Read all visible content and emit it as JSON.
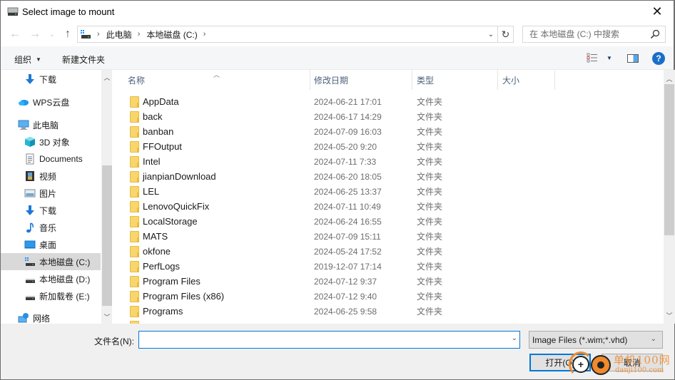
{
  "window": {
    "title": "Select image to mount",
    "close_label": "✕"
  },
  "nav": {
    "back_icon": "←",
    "forward_icon": "→",
    "recent_icon": "⌄",
    "up_icon": "↑",
    "breadcrumbs": [
      "此电脑",
      "本地磁盘 (C:)"
    ],
    "refresh_icon": "↻",
    "search_placeholder": "在 本地磁盘 (C:) 中搜索"
  },
  "toolbar": {
    "organize_label": "组织",
    "new_folder_label": "新建文件夹",
    "help_label": "?"
  },
  "sidebar": {
    "items": [
      {
        "label": "下载",
        "icon": "download-icon",
        "indent": 2
      },
      {
        "label": "WPS云盘",
        "icon": "cloud-icon",
        "indent": 1
      },
      {
        "label": "此电脑",
        "icon": "computer-icon",
        "indent": 1
      },
      {
        "label": "3D 对象",
        "icon": "3d-objects-icon",
        "indent": 2
      },
      {
        "label": "Documents",
        "icon": "documents-icon",
        "indent": 2
      },
      {
        "label": "视频",
        "icon": "video-icon",
        "indent": 2
      },
      {
        "label": "图片",
        "icon": "pictures-icon",
        "indent": 2
      },
      {
        "label": "下载",
        "icon": "download-icon",
        "indent": 2
      },
      {
        "label": "音乐",
        "icon": "music-icon",
        "indent": 2
      },
      {
        "label": "桌面",
        "icon": "desktop-icon",
        "indent": 2
      },
      {
        "label": "本地磁盘 (C:)",
        "icon": "system-drive-icon",
        "indent": 2,
        "selected": true
      },
      {
        "label": "本地磁盘 (D:)",
        "icon": "drive-icon",
        "indent": 2
      },
      {
        "label": "新加载卷 (E:)",
        "icon": "drive-icon",
        "indent": 2
      },
      {
        "label": "网络",
        "icon": "network-icon",
        "indent": 1
      }
    ]
  },
  "filelist": {
    "columns": [
      "名称",
      "修改日期",
      "类型",
      "大小"
    ],
    "rows": [
      {
        "name": "AppData",
        "date": "2024-06-21 17:01",
        "type": "文件夹"
      },
      {
        "name": "back",
        "date": "2024-06-17 14:29",
        "type": "文件夹"
      },
      {
        "name": "banban",
        "date": "2024-07-09 16:03",
        "type": "文件夹"
      },
      {
        "name": "FFOutput",
        "date": "2024-05-20 9:20",
        "type": "文件夹"
      },
      {
        "name": "Intel",
        "date": "2024-07-11 7:33",
        "type": "文件夹"
      },
      {
        "name": "jianpianDownload",
        "date": "2024-06-20 18:05",
        "type": "文件夹"
      },
      {
        "name": "LEL",
        "date": "2024-06-25 13:37",
        "type": "文件夹"
      },
      {
        "name": "LenovoQuickFix",
        "date": "2024-07-11 10:49",
        "type": "文件夹"
      },
      {
        "name": "LocalStorage",
        "date": "2024-06-24 16:55",
        "type": "文件夹"
      },
      {
        "name": "MATS",
        "date": "2024-07-09 15:11",
        "type": "文件夹"
      },
      {
        "name": "okfone",
        "date": "2024-05-24 17:52",
        "type": "文件夹"
      },
      {
        "name": "PerfLogs",
        "date": "2019-12-07 17:14",
        "type": "文件夹"
      },
      {
        "name": "Program Files",
        "date": "2024-07-12 9:37",
        "type": "文件夹"
      },
      {
        "name": "Program Files (x86)",
        "date": "2024-07-12 9:40",
        "type": "文件夹"
      },
      {
        "name": "Programs",
        "date": "2024-06-25 9:58",
        "type": "文件夹"
      }
    ]
  },
  "bottom": {
    "filename_label": "文件名(N):",
    "filename_value": "",
    "filter_value": "Image Files (*.wim;*.vhd)",
    "open_label": "打开(O)",
    "cancel_label": "取消"
  },
  "watermark": {
    "cn": "单机100网",
    "en": "danji100.com"
  }
}
